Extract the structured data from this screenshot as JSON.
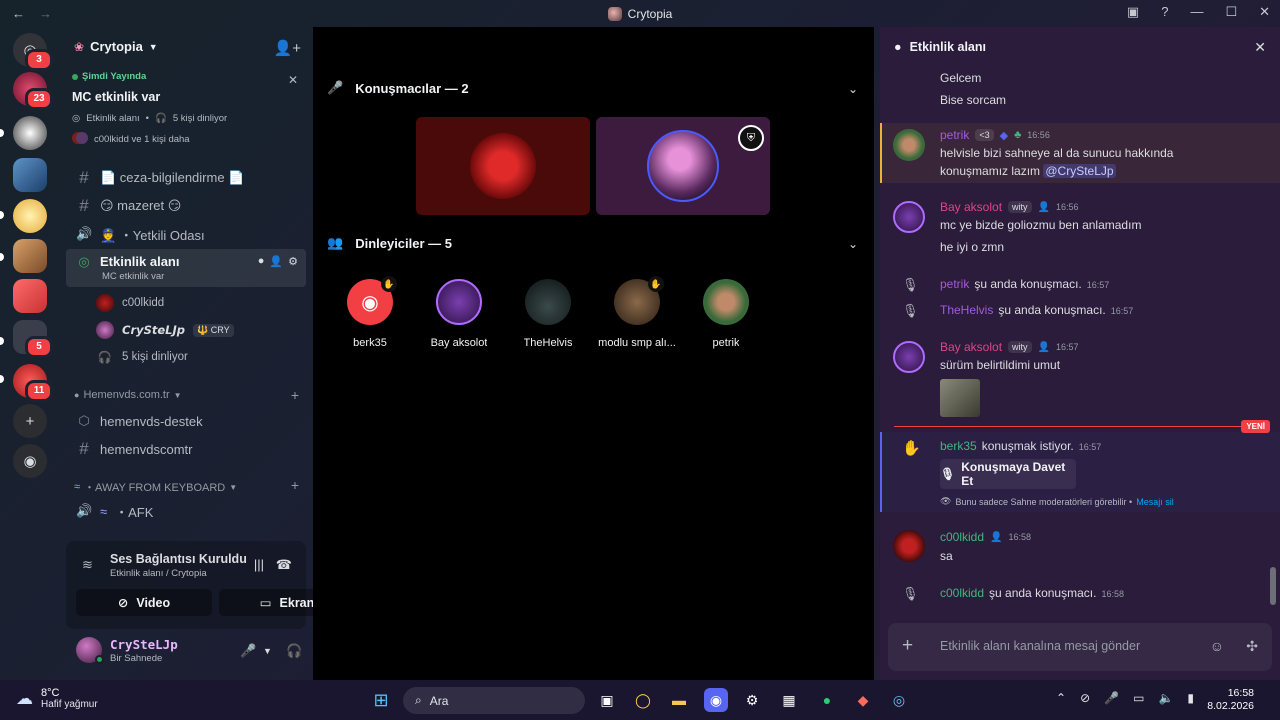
{
  "window": {
    "title": "Crytopia"
  },
  "rail": {
    "servers": [
      {
        "name": "discord-home",
        "badge": "3",
        "color": "#5865f2"
      },
      {
        "name": "server-red",
        "badge": "23",
        "color": "#a3213a"
      },
      {
        "name": "server-anime",
        "badge": "",
        "color": "#e8e8e8"
      },
      {
        "name": "server-blue",
        "badge": "",
        "color": "#3d6fa8"
      },
      {
        "name": "server-yellow",
        "badge": "",
        "color": "#f2c94c"
      },
      {
        "name": "server-dog",
        "badge": "",
        "color": "#c08a5a"
      },
      {
        "name": "server-cash",
        "badge": "",
        "color": "#e24b4b"
      },
      {
        "name": "server-group",
        "badge": "5",
        "color": "#888"
      },
      {
        "name": "server-gold",
        "badge": "11",
        "color": "#e24b4b"
      }
    ]
  },
  "sidebar": {
    "server_name": "Crytopia",
    "live": {
      "label": "Şimdi Yayında",
      "title": "MC etkinlik var",
      "area": "Etkinlik alanı",
      "listeners": "5 kişi dinliyor",
      "users": "c00lkidd ve 1 kişi daha"
    },
    "channels": [
      {
        "name": "📄 ceza-bilgilendirme 📄",
        "type": "text"
      },
      {
        "name": "😏 mazeret 😏",
        "type": "text"
      },
      {
        "name": "👮 ・Yetkili Odası",
        "type": "voice"
      }
    ],
    "active_channel": {
      "name": "Etkinlik alanı",
      "sub": "MC etkinlik var"
    },
    "stage_users": [
      {
        "name": "c00lkidd",
        "color": "#8a1a1a"
      },
      {
        "name": "𝘾𝙧𝙮𝙎𝙩𝙚𝙇𝙅𝙥",
        "tag": "🔱 CRY",
        "color": "#6a3a7a"
      }
    ],
    "stage_listening": "5 kişi dinliyor",
    "categories": [
      {
        "name": "Hemenvds.com.tr",
        "channels": [
          "hemenvds-destek",
          "hemenvdscomtr"
        ]
      },
      {
        "name": "・AWAY FROM KEYBOARD",
        "channels": [
          "・AFK"
        ]
      }
    ],
    "voice_panel": {
      "status": "Ses Bağlantısı Kuruldu",
      "sub": "Etkinlik alanı / Crytopia",
      "video": "Video",
      "screen": "Ekran"
    },
    "user": {
      "name": "CrySteLJp",
      "sub": "Bir Sahnede"
    }
  },
  "stage": {
    "speakers_label": "Konuşmacılar — 2",
    "listeners_label": "Dinleyiciler — 5",
    "listeners": [
      {
        "name": "berk35",
        "color": "#f23f43",
        "hand": true
      },
      {
        "name": "Bay aksolot",
        "color": "#7a3fb0",
        "hand": false
      },
      {
        "name": "TheHelvis",
        "color": "#1d2a2a",
        "hand": false
      },
      {
        "name": "modlu smp alı...",
        "color": "#5a4a3a",
        "hand": true
      },
      {
        "name": "petrik",
        "color": "#3a6a3a",
        "hand": false
      }
    ]
  },
  "chat": {
    "title": "Etkinlik alanı",
    "lines_top": [
      "Gelcem",
      "Bise sorcam"
    ],
    "messages": [
      {
        "author": "petrik",
        "author_color": "#a25be0",
        "tag": "<3",
        "time": "16:56",
        "lines": [
          "helvisle bizi sahneye al da sunucu hakkında",
          "konuşmamız lazım"
        ],
        "mention": "@CrySteLJp"
      },
      {
        "author": "Bay aksolot",
        "author_color": "#e0448a",
        "tag": "wity",
        "time": "16:56",
        "lines": [
          "mc ye bizde goliozmu ben anlamadım",
          "he iyi o zmn"
        ]
      }
    ],
    "system_speaking": [
      {
        "author": "petrik",
        "author_color": "#a25be0",
        "text": "şu anda konuşmacı.",
        "time": "16:57"
      },
      {
        "author": "TheHelvis",
        "author_color": "#a25be0",
        "text": "şu anda konuşmacı.",
        "time": "16:57"
      }
    ],
    "message3": {
      "author": "Bay aksolot",
      "author_color": "#e0448a",
      "tag": "wity",
      "time": "16:57",
      "text": "sürüm belirtildimi umut"
    },
    "new_label": "YENİ",
    "request": {
      "author": "berk35",
      "author_color": "#43b581",
      "text": "konuşmak istiyor.",
      "time": "16:57",
      "button": "Konuşmaya Davet Et",
      "ephemeral": "Bunu sadece Sahne moderatörleri görebilir •",
      "delete": "Mesajı sil"
    },
    "message4": {
      "author": "c00lkidd",
      "author_color": "#43b581",
      "time": "16:58",
      "text": "sa"
    },
    "system_last": {
      "author": "c00lkidd",
      "author_color": "#43b581",
      "text": "şu anda konuşmacı.",
      "time": "16:58"
    },
    "input_placeholder": "Etkinlik alanı kanalına mesaj gönder"
  },
  "taskbar": {
    "temp": "8°C",
    "weather": "Hafif yağmur",
    "search": "Ara",
    "time": "16:58",
    "date": "8.02.2026"
  }
}
